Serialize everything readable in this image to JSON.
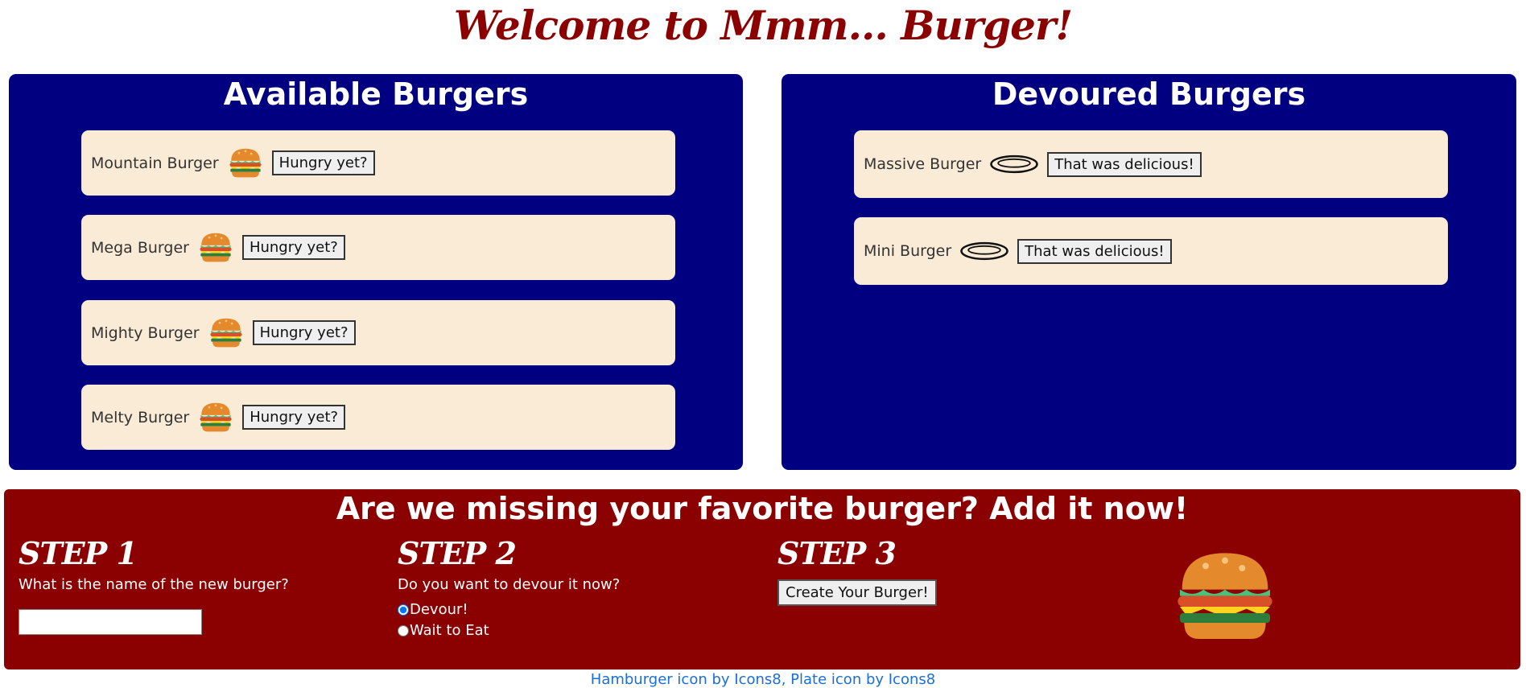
{
  "header": {
    "title": "Welcome to Mmm... Burger!"
  },
  "available": {
    "heading": "Available Burgers",
    "items": [
      {
        "name": "Mountain Burger",
        "button": "Hungry yet?"
      },
      {
        "name": "Mega Burger",
        "button": "Hungry yet?"
      },
      {
        "name": "Mighty Burger",
        "button": "Hungry yet?"
      },
      {
        "name": "Melty Burger",
        "button": "Hungry yet?"
      }
    ]
  },
  "devoured": {
    "heading": "Devoured Burgers",
    "items": [
      {
        "name": "Massive Burger",
        "button": "That was delicious!"
      },
      {
        "name": "Mini Burger",
        "button": "That was delicious!"
      }
    ]
  },
  "add": {
    "heading": "Are we missing your favorite burger? Add it now!",
    "step1": {
      "title": "STEP 1",
      "question": "What is the name of the new burger?",
      "input_value": ""
    },
    "step2": {
      "title": "STEP 2",
      "question": "Do you want to devour it now?",
      "options": [
        "Devour!",
        "Wait to Eat"
      ],
      "selected": "Devour!"
    },
    "step3": {
      "title": "STEP 3",
      "button": "Create Your Burger!"
    }
  },
  "footer": {
    "hamburger_credit": "Hamburger icon by Icons8",
    "separator": ", ",
    "plate_credit": "Plate icon by Icons8"
  },
  "colors": {
    "title": "#8b0000",
    "panel": "#000080",
    "card": "#faebd7",
    "add_section": "#8b0000",
    "link": "#1a6fd6"
  },
  "icons": {
    "burger": "hamburger-icon",
    "plate": "plate-icon"
  }
}
